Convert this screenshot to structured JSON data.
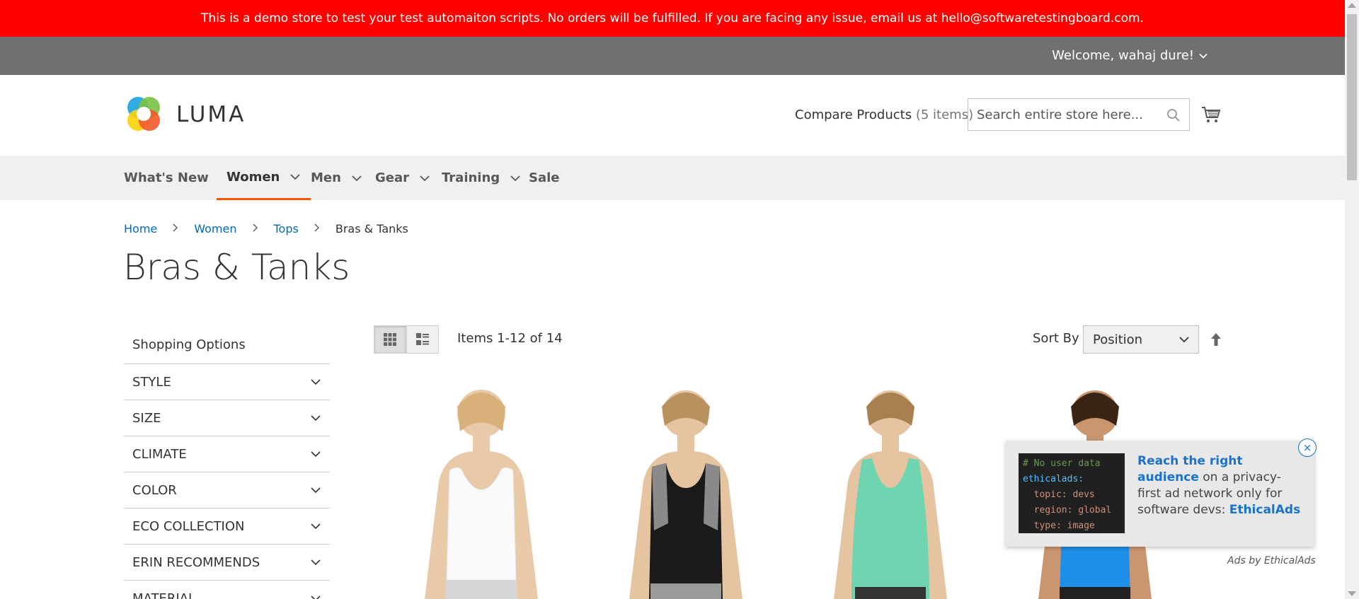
{
  "banner": {
    "text": "This is a demo store to test your test automaiton scripts. No orders will be fulfilled. If you are facing any issue, email us at hello@softwaretestingboard.com."
  },
  "top_bar": {
    "welcome": "Welcome, wahaj dure!"
  },
  "header": {
    "logo_text": "LUMA",
    "compare_label": "Compare Products",
    "compare_count": "(5 items)",
    "search_placeholder": "Search entire store here..."
  },
  "nav": {
    "items": [
      {
        "label": "What's New"
      },
      {
        "label": "Women"
      },
      {
        "label": "Men"
      },
      {
        "label": "Gear"
      },
      {
        "label": "Training"
      },
      {
        "label": "Sale"
      }
    ]
  },
  "breadcrumb": {
    "items": [
      "Home",
      "Women",
      "Tops",
      "Bras & Tanks"
    ]
  },
  "page_title": "Bras & Tanks",
  "sidebar": {
    "title": "Shopping Options",
    "filters": [
      "STYLE",
      "SIZE",
      "CLIMATE",
      "COLOR",
      "ECO COLLECTION",
      "ERIN RECOMMENDS",
      "MATERIAL"
    ]
  },
  "toolbar": {
    "items_count": "Items 1-12 of 14",
    "sort_label": "Sort By",
    "sort_value": "Position"
  },
  "ad": {
    "code_lines": [
      "# No user data",
      "ethicalads:",
      "  topic: devs",
      "  region: global",
      "  type: image"
    ],
    "headline": "Reach the right audience",
    "body": " on a privacy-first ad network only for software devs: ",
    "link": "EthicalAds",
    "close": "×",
    "credit": "Ads by EthicalAds"
  },
  "colors": {
    "banner": "#ff0000",
    "top_bar": "#6e716e",
    "nav_bg": "#f0f0f0",
    "nav_active_underline": "#ff5501",
    "link": "#006bb4"
  }
}
